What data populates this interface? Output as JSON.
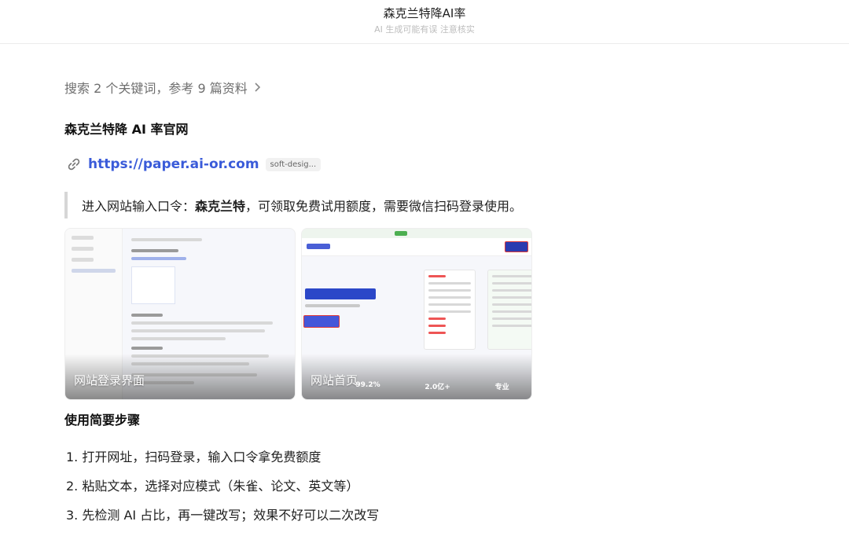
{
  "header": {
    "title": "森克兰特降AI率",
    "subtitle": "AI 生成可能有误 注意核实"
  },
  "search": {
    "summary": "搜索 2 个关键词，参考 9 篇资料"
  },
  "sections": {
    "official_title": "森克兰特降 AI 率官网",
    "link_url": "https://paper.ai-or.com",
    "link_tag": "soft-desig...",
    "quote_prefix": "进入网站输入口令：",
    "quote_bold": "森克兰特",
    "quote_suffix": "，可领取免费试用额度，需要微信扫码登录使用。",
    "steps_title": "使用简要步骤"
  },
  "images": [
    {
      "caption": "网站登录界面"
    },
    {
      "caption": "网站首页"
    }
  ],
  "image_stats": [
    "99.2%",
    "2.0亿+",
    "专业"
  ],
  "steps": [
    "1. 打开网址，扫码登录，输入口令拿免费额度",
    "2. 粘贴文本，选择对应模式（朱雀、论文、英文等）",
    "3. 先检测 AI 占比，再一键改写；效果不好可以二次改写"
  ],
  "icons": [
    "chevron-right-icon",
    "link-icon"
  ],
  "colors": {
    "link": "#3a5bd9",
    "quote_bar": "#d6d6d6",
    "muted": "#6f6f6f"
  }
}
